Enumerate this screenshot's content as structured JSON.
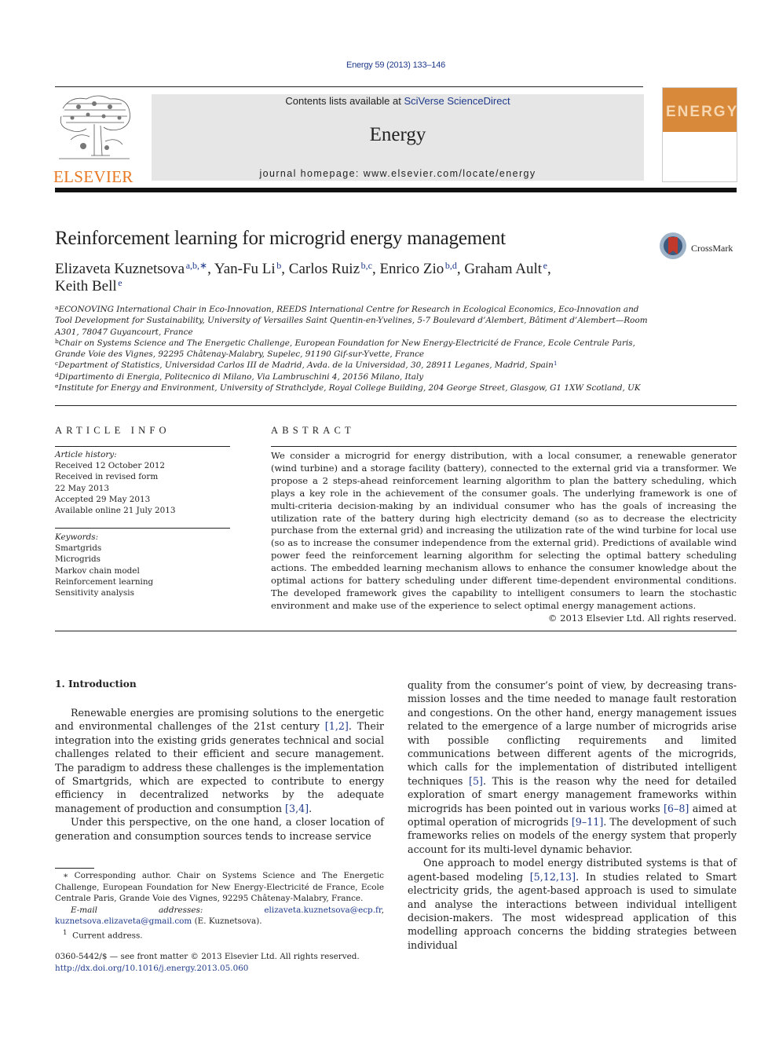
{
  "header": {
    "journal_ref": "Energy 59 (2013) 133–146",
    "contents_prefix": "Contents lists available at ",
    "contents_link": "SciVerse ScienceDirect",
    "journal_name": "Energy",
    "homepage_prefix": "journal homepage: ",
    "homepage_url": "www.elsevier.com/locate/energy",
    "publisher_logo_text": "ELSEVIER",
    "cover_word": "ENERGY",
    "brand_color": "#e87722"
  },
  "article": {
    "title": "Reinforcement learning for microgrid energy management",
    "crossmark_label": "CrossMark",
    "authors": [
      {
        "name": "Elizaveta Kuznetsova",
        "sup": "a,b,∗",
        "sep": ", "
      },
      {
        "name": "Yan-Fu Li",
        "sup": "b",
        "sep": ", "
      },
      {
        "name": "Carlos Ruiz",
        "sup": "b,c",
        "sep": ", "
      },
      {
        "name": "Enrico Zio",
        "sup": "b,d",
        "sep": ", "
      },
      {
        "name": "Graham Ault",
        "sup": "e",
        "sep": ","
      },
      {
        "name": "Keith Bell",
        "sup": "e",
        "sep": ""
      }
    ],
    "affiliations": [
      {
        "key": "a",
        "text": "ECONOVING International Chair in Eco-Innovation, REEDS International Centre for Research in Ecological Economics, Eco-Innovation and Tool Development for Sustainability, University of Versailles Saint Quentin-en-Yvelines, 5-7 Boulevard d’Alembert, Bâtiment d’Alembert—Room A301, 78047 Guyancourt, France"
      },
      {
        "key": "b",
        "text": "Chair on Systems Science and The Energetic Challenge, European Foundation for New Energy-Electricité de France, Ecole Centrale Paris, Grande Voie des Vignes, 92295 Châtenay-Malabry, Supelec, 91190 Gif-sur-Yvette, France"
      },
      {
        "key": "c",
        "text": "Department of Statistics, Universidad Carlos III de Madrid, Avda. de la Universidad, 30, 28911 Leganes, Madrid, Spain",
        "footnote": "1"
      },
      {
        "key": "d",
        "text": "Dipartimento di Energia, Politecnico di Milano, Via Lambruschini 4, 20156 Milano, Italy"
      },
      {
        "key": "e",
        "text": "Institute for Energy and Environment, University of Strathclyde, Royal College Building, 204 George Street, Glasgow, G1 1XW Scotland, UK"
      }
    ]
  },
  "article_info": {
    "heading": "ARTICLE INFO",
    "history_label": "Article history:",
    "history": [
      "Received 12 October 2012",
      "Received in revised form",
      "22 May 2013",
      "Accepted 29 May 2013",
      "Available online 21 July 2013"
    ],
    "keywords_label": "Keywords:",
    "keywords": [
      "Smartgrids",
      "Microgrids",
      "Markov chain model",
      "Reinforcement learning",
      "Sensitivity analysis"
    ]
  },
  "abstract": {
    "heading": "ABSTRACT",
    "text": "We consider a microgrid for energy distribution, with a local consumer, a renewable generator (wind turbine) and a storage facility (battery), connected to the external grid via a transformer. We propose a 2 steps-ahead reinforcement learning algorithm to plan the battery scheduling, which plays a key role in the achievement of the consumer goals. The underlying framework is one of multi-criteria decision-making by an individual consumer who has the goals of increasing the utilization rate of the battery during high electricity demand (so as to decrease the electricity purchase from the external grid) and increasing the utilization rate of the wind turbine for local use (so as to increase the consumer inde­pendence from the external grid). Predictions of available wind power feed the reinforcement learning algorithm for selecting the optimal battery scheduling actions. The embedded learning mechanism al­lows to enhance the consumer knowledge about the optimal actions for battery scheduling under different time-dependent environmental conditions. The developed framework gives the capability to intelligent consumers to learn the stochastic environment and make use of the experience to select optimal energy management actions.",
    "copyright": "© 2013 Elsevier Ltd. All rights reserved."
  },
  "body": {
    "section_title": "1.  Introduction",
    "left_paragraphs": [
      [
        {
          "t": "Renewable energies are promising solutions to the energetic and environmental challenges of the 21st century "
        },
        {
          "ref": "[1,2]"
        },
        {
          "t": ". Their integration into the existing grids generates technical and social challenges related to their efficient and secure management. The paradigm to address these challenges is the implementation of Smartgrids, which are expected to contribute to energy efficiency in decentralized networks by the adequate management of produc­tion and consumption "
        },
        {
          "ref": "[3,4]"
        },
        {
          "t": "."
        }
      ],
      [
        {
          "t": "Under this perspective, on the one hand, a closer location of generation and consumption sources tends to increase service"
        }
      ]
    ],
    "right_paragraphs": [
      {
        "noindent": true,
        "parts": [
          {
            "t": "quality from the consumer’s point of view, by decreasing trans­mission losses and the time needed to manage fault restoration and congestions. On the other hand, energy management issues related to the emergence of a large number of microgrids arise with possible conflicting requirements and limited communications between different agents of the microgrids, which calls for the implementation of distributed intelligent techniques "
          },
          {
            "ref": "[5]"
          },
          {
            "t": ". This is the reason why the need for detailed exploration of smart energy management frameworks within microgrids has been pointed out in various works "
          },
          {
            "ref": "[6–8]"
          },
          {
            "t": " aimed at optimal operation of microgrids "
          },
          {
            "ref": "[9–11]"
          },
          {
            "t": ". The development of such frameworks relies on models of the energy system that properly account for its multi-level dynamic behavior."
          }
        ]
      },
      {
        "noindent": false,
        "parts": [
          {
            "t": "One approach to model energy distributed systems is that of agent-based modeling "
          },
          {
            "ref": "[5,12,13]"
          },
          {
            "t": ". In studies related to Smart elec­tricity grids, the agent-based approach is used to simulate and analyse the interactions between individual intelligent decision-makers. The most widespread application of this modelling approach concerns the bidding strategies between individual"
          }
        ]
      }
    ]
  },
  "footnotes": {
    "corresponding_mark": "∗",
    "corresponding_text": "Corresponding author. Chair on Systems Science and The Energetic Challenge, European Foundation for New Energy-Electricité de France, Ecole Centrale Paris, Grande Voie des Vignes, 92295 Châtenay-Malabry, France.",
    "email_label": "E-mail addresses:",
    "email_1": "elizaveta.kuznetsova@ecp.fr",
    "email_sep": ", ",
    "email_2": "kuznetsova.elizaveta@gmail.com",
    "email_owner": "(E. Kuznetsova).",
    "fn1_mark": "1",
    "fn1_text": "Current address.",
    "issn_line": "0360-5442/$ — see front matter © 2013 Elsevier Ltd. All rights reserved.",
    "doi": "http://dx.doi.org/10.1016/j.energy.2013.05.060"
  }
}
